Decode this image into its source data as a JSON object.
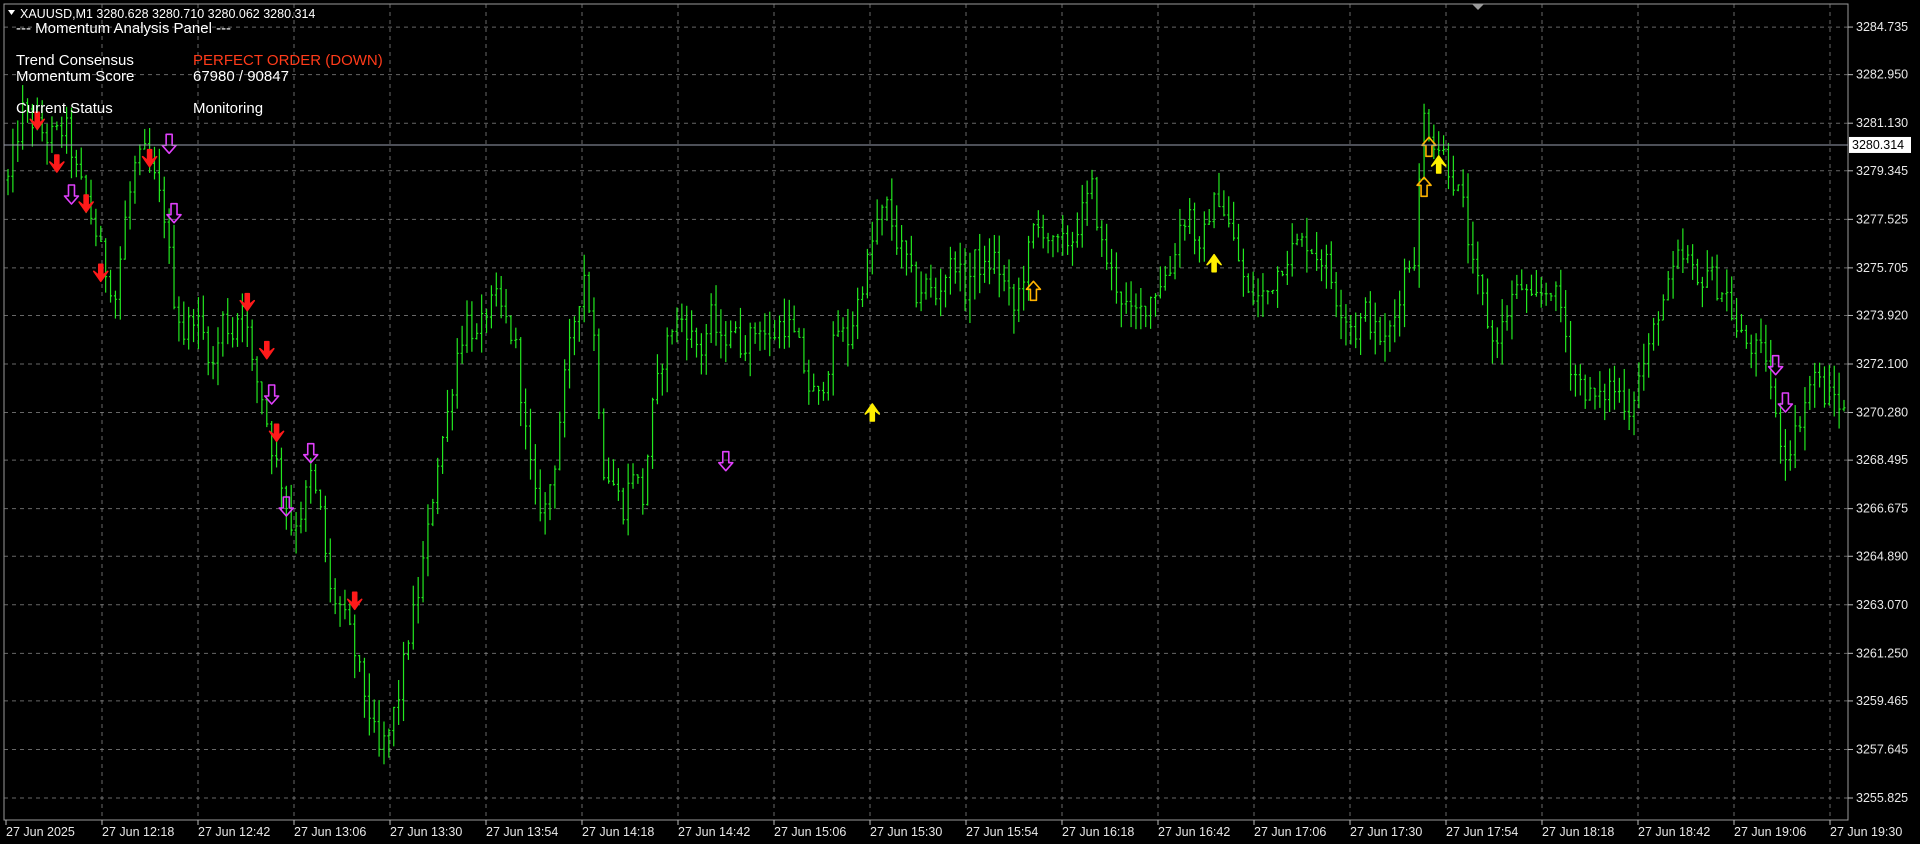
{
  "header": {
    "symbol_line": "XAUUSD,M1  3280.628 3280.710 3280.062 3280.314",
    "panel_title": "--- Momentum Analysis Panel ---"
  },
  "panel": {
    "trend_label": "Trend Consensus",
    "trend_value": "PERFECT ORDER (DOWN)",
    "momentum_label": "Momentum Score",
    "momentum_value": "67980 / 90847",
    "status_label": "Current Status",
    "status_value": "Monitoring"
  },
  "colors": {
    "background": "#000000",
    "candles": "#22e81f",
    "grid": "#8a8a8a",
    "trend_value": "#ff3b1a",
    "sell_arrow": "#ff1a1a",
    "sell_hollow_arrow": "#e040fb",
    "buy_arrow": "#ffef00",
    "buy_hollow_arrow": "#ffb300",
    "price_line": "#9aa0b0"
  },
  "chart_data": {
    "type": "candlestick",
    "title": "XAUUSD,M1",
    "timeframe": "M1",
    "ohlc_last": {
      "open": 3280.628,
      "high": 3280.71,
      "low": 3280.062,
      "close": 3280.314
    },
    "current_price": "3280.314",
    "y_ticks": [
      "3284.735",
      "3282.950",
      "3281.130",
      "3279.345",
      "3277.525",
      "3275.705",
      "3273.920",
      "3272.100",
      "3270.280",
      "3268.495",
      "3266.675",
      "3264.890",
      "3263.070",
      "3261.250",
      "3259.465",
      "3257.645",
      "3255.825"
    ],
    "ylim": [
      3255.0,
      3285.6
    ],
    "x_ticks": [
      "27 Jun 2025",
      "27 Jun 12:18",
      "27 Jun 12:42",
      "27 Jun 13:06",
      "27 Jun 13:30",
      "27 Jun 13:54",
      "27 Jun 14:18",
      "27 Jun 14:42",
      "27 Jun 15:06",
      "27 Jun 15:30",
      "27 Jun 15:54",
      "27 Jun 16:18",
      "27 Jun 16:42",
      "27 Jun 17:06",
      "27 Jun 17:30",
      "27 Jun 17:54",
      "27 Jun 18:18",
      "27 Jun 18:42",
      "27 Jun 19:06",
      "27 Jun 19:30"
    ],
    "grid": true,
    "close_path": [
      [
        0,
        3279.0
      ],
      [
        3,
        3281.6
      ],
      [
        8,
        3280.6
      ],
      [
        12,
        3280.9
      ],
      [
        14,
        3279.3
      ],
      [
        16,
        3278.3
      ],
      [
        18,
        3277.0
      ],
      [
        20,
        3275.6
      ],
      [
        22,
        3274.6
      ],
      [
        24,
        3277.5
      ],
      [
        26,
        3279.5
      ],
      [
        28,
        3280.0
      ],
      [
        30,
        3279.0
      ],
      [
        32,
        3277.7
      ],
      [
        34,
        3274.6
      ],
      [
        36,
        3273.2
      ],
      [
        38,
        3274.0
      ],
      [
        40,
        3273.2
      ],
      [
        42,
        3272.0
      ],
      [
        44,
        3273.8
      ],
      [
        46,
        3273.2
      ],
      [
        48,
        3274.6
      ],
      [
        50,
        3272.0
      ],
      [
        52,
        3270.9
      ],
      [
        54,
        3269.0
      ],
      [
        56,
        3267.7
      ],
      [
        58,
        3266.0
      ],
      [
        60,
        3266.5
      ],
      [
        62,
        3267.9
      ],
      [
        64,
        3266.5
      ],
      [
        66,
        3263.5
      ],
      [
        68,
        3263.0
      ],
      [
        70,
        3262.0
      ],
      [
        72,
        3260.5
      ],
      [
        74,
        3259.0
      ],
      [
        76,
        3257.5
      ],
      [
        78,
        3258.3
      ],
      [
        80,
        3259.7
      ],
      [
        82,
        3261.9
      ],
      [
        84,
        3263.5
      ],
      [
        86,
        3265.8
      ],
      [
        88,
        3268.5
      ],
      [
        90,
        3270.2
      ],
      [
        92,
        3272.5
      ],
      [
        94,
        3273.8
      ],
      [
        96,
        3273.0
      ],
      [
        98,
        3274.1
      ],
      [
        100,
        3274.5
      ],
      [
        102,
        3273.7
      ],
      [
        104,
        3272.7
      ],
      [
        106,
        3269.5
      ],
      [
        108,
        3267.0
      ],
      [
        110,
        3266.7
      ],
      [
        112,
        3268.5
      ],
      [
        114,
        3271.5
      ],
      [
        116,
        3273.8
      ],
      [
        118,
        3275.5
      ],
      [
        120,
        3273.1
      ],
      [
        122,
        3268.2
      ],
      [
        124,
        3267.6
      ],
      [
        126,
        3266.7
      ],
      [
        128,
        3268.2
      ],
      [
        130,
        3267.0
      ],
      [
        132,
        3270.4
      ],
      [
        134,
        3272.3
      ],
      [
        136,
        3273.5
      ],
      [
        138,
        3273.8
      ],
      [
        140,
        3273.1
      ],
      [
        142,
        3272.6
      ],
      [
        144,
        3273.9
      ],
      [
        146,
        3272.8
      ],
      [
        148,
        3273.5
      ],
      [
        150,
        3272.8
      ],
      [
        152,
        3273.1
      ],
      [
        154,
        3273.6
      ],
      [
        156,
        3272.9
      ],
      [
        158,
        3273.6
      ],
      [
        160,
        3273.5
      ],
      [
        162,
        3272.7
      ],
      [
        164,
        3271.2
      ],
      [
        166,
        3270.8
      ],
      [
        168,
        3272.1
      ],
      [
        170,
        3273.4
      ],
      [
        172,
        3273.0
      ],
      [
        174,
        3274.4
      ],
      [
        176,
        3275.9
      ],
      [
        178,
        3277.4
      ],
      [
        180,
        3278.0
      ],
      [
        182,
        3276.7
      ],
      [
        184,
        3276.0
      ],
      [
        186,
        3274.7
      ],
      [
        188,
        3275.1
      ],
      [
        190,
        3274.6
      ],
      [
        192,
        3275.5
      ],
      [
        194,
        3276.0
      ],
      [
        196,
        3274.8
      ],
      [
        198,
        3276.0
      ],
      [
        200,
        3275.6
      ],
      [
        202,
        3276.1
      ],
      [
        204,
        3275.1
      ],
      [
        206,
        3274.1
      ],
      [
        208,
        3275.5
      ],
      [
        210,
        3277.1
      ],
      [
        212,
        3277.2
      ],
      [
        214,
        3276.5
      ],
      [
        216,
        3276.6
      ],
      [
        218,
        3276.8
      ],
      [
        220,
        3277.8
      ],
      [
        222,
        3278.7
      ],
      [
        224,
        3276.5
      ],
      [
        226,
        3275.5
      ],
      [
        228,
        3274.6
      ],
      [
        230,
        3273.9
      ],
      [
        232,
        3274.1
      ],
      [
        234,
        3274.6
      ],
      [
        236,
        3275.2
      ],
      [
        238,
        3275.6
      ],
      [
        240,
        3277.3
      ],
      [
        242,
        3277.8
      ],
      [
        244,
        3276.1
      ],
      [
        246,
        3277.8
      ],
      [
        248,
        3278.4
      ],
      [
        250,
        3277.3
      ],
      [
        252,
        3276.0
      ],
      [
        254,
        3274.6
      ],
      [
        256,
        3274.6
      ],
      [
        258,
        3274.8
      ],
      [
        260,
        3275.6
      ],
      [
        262,
        3276.2
      ],
      [
        264,
        3276.6
      ],
      [
        266,
        3276.7
      ],
      [
        268,
        3276.2
      ],
      [
        270,
        3275.9
      ],
      [
        272,
        3274.6
      ],
      [
        274,
        3273.9
      ],
      [
        276,
        3273.3
      ],
      [
        278,
        3274.1
      ],
      [
        280,
        3273.3
      ],
      [
        282,
        3272.9
      ],
      [
        284,
        3273.9
      ],
      [
        286,
        3275.6
      ],
      [
        288,
        3276.2
      ],
      [
        290,
        3281.4
      ],
      [
        292,
        3280.5
      ],
      [
        294,
        3280.0
      ],
      [
        296,
        3279.0
      ],
      [
        298,
        3278.0
      ],
      [
        300,
        3275.6
      ],
      [
        302,
        3274.5
      ],
      [
        304,
        3272.9
      ],
      [
        306,
        3273.5
      ],
      [
        308,
        3274.6
      ],
      [
        310,
        3275.0
      ],
      [
        312,
        3274.3
      ],
      [
        314,
        3274.7
      ],
      [
        316,
        3275.0
      ],
      [
        318,
        3274.2
      ],
      [
        320,
        3272.1
      ],
      [
        322,
        3271.4
      ],
      [
        324,
        3270.9
      ],
      [
        326,
        3270.7
      ],
      [
        328,
        3271.3
      ],
      [
        330,
        3271.0
      ],
      [
        332,
        3270.4
      ],
      [
        334,
        3271.6
      ],
      [
        336,
        3272.6
      ],
      [
        338,
        3274.1
      ],
      [
        340,
        3274.9
      ],
      [
        342,
        3276.0
      ],
      [
        344,
        3276.0
      ],
      [
        346,
        3275.0
      ],
      [
        348,
        3275.7
      ],
      [
        350,
        3275.0
      ],
      [
        352,
        3274.7
      ],
      [
        354,
        3273.3
      ],
      [
        356,
        3272.9
      ],
      [
        358,
        3272.6
      ],
      [
        360,
        3272.4
      ],
      [
        362,
        3270.0
      ],
      [
        364,
        3268.7
      ],
      [
        366,
        3269.5
      ],
      [
        368,
        3270.7
      ],
      [
        370,
        3271.8
      ],
      [
        372,
        3270.9
      ],
      [
        374,
        3270.9
      ],
      [
        376,
        3270.3
      ]
    ],
    "signals": [
      {
        "type": "sell",
        "style": "solid",
        "bar": 6,
        "price": 3281.2
      },
      {
        "type": "sell",
        "style": "solid",
        "bar": 10,
        "price": 3279.6
      },
      {
        "type": "sell",
        "style": "hollow",
        "bar": 13,
        "price": 3278.4
      },
      {
        "type": "sell",
        "style": "solid",
        "bar": 16,
        "price": 3278.1
      },
      {
        "type": "sell",
        "style": "solid",
        "bar": 19,
        "price": 3275.5
      },
      {
        "type": "sell",
        "style": "solid",
        "bar": 29,
        "price": 3279.8
      },
      {
        "type": "sell",
        "style": "hollow",
        "bar": 33,
        "price": 3280.3
      },
      {
        "type": "sell",
        "style": "hollow",
        "bar": 34,
        "price": 3277.7
      },
      {
        "type": "sell",
        "style": "solid",
        "bar": 49,
        "price": 3274.4
      },
      {
        "type": "sell",
        "style": "solid",
        "bar": 53,
        "price": 3272.6
      },
      {
        "type": "sell",
        "style": "hollow",
        "bar": 54,
        "price": 3270.9
      },
      {
        "type": "sell",
        "style": "solid",
        "bar": 55,
        "price": 3269.5
      },
      {
        "type": "sell",
        "style": "hollow",
        "bar": 62,
        "price": 3268.7
      },
      {
        "type": "sell",
        "style": "hollow",
        "bar": 57,
        "price": 3266.7
      },
      {
        "type": "sell",
        "style": "solid",
        "bar": 71,
        "price": 3263.2
      },
      {
        "type": "sell",
        "style": "hollow",
        "bar": 147,
        "price": 3268.4
      },
      {
        "type": "buy",
        "style": "solid",
        "bar": 177,
        "price": 3270.3
      },
      {
        "type": "buy",
        "style": "hollow",
        "bar": 210,
        "price": 3274.9
      },
      {
        "type": "buy",
        "style": "solid",
        "bar": 247,
        "price": 3275.9
      },
      {
        "type": "buy",
        "style": "hollow",
        "bar": 290,
        "price": 3278.8
      },
      {
        "type": "buy",
        "style": "hollow",
        "bar": 291,
        "price": 3280.3
      },
      {
        "type": "buy",
        "style": "solid",
        "bar": 293,
        "price": 3279.6
      },
      {
        "type": "sell",
        "style": "hollow",
        "bar": 362,
        "price": 3272.0
      },
      {
        "type": "sell",
        "style": "hollow",
        "bar": 364,
        "price": 3270.6
      }
    ]
  }
}
